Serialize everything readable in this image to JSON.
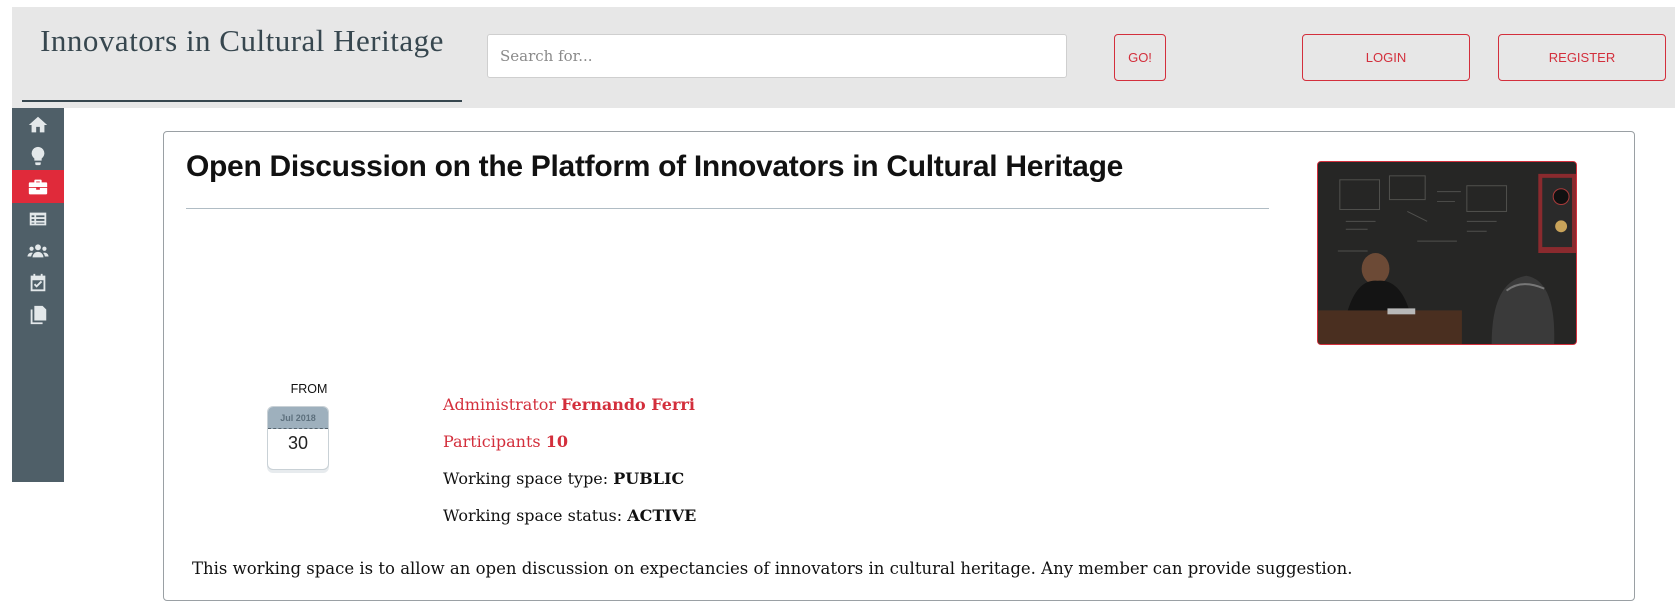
{
  "header": {
    "brand": "Innovators in Cultural Heritage",
    "search_placeholder": "Search for...",
    "go_label": "GO!",
    "login_label": "LOGIN",
    "register_label": "REGISTER",
    "background": "#e7e7e7"
  },
  "sidebar": {
    "items": [
      {
        "name": "home-icon",
        "active": false
      },
      {
        "name": "lightbulb-icon",
        "active": false
      },
      {
        "name": "briefcase-icon",
        "active": true
      },
      {
        "name": "list-icon",
        "active": false
      },
      {
        "name": "users-icon",
        "active": false
      },
      {
        "name": "calendar-check-icon",
        "active": false
      },
      {
        "name": "copy-icon",
        "active": false
      }
    ],
    "background": "#4f5f68",
    "active_color": "#e02a3a"
  },
  "space": {
    "title": "Open Discussion on the Platform of Innovators in Cultural Heritage",
    "from_label": "FROM",
    "date_month": "Jul 2018",
    "date_day": "30",
    "admin_label": "Administrator",
    "admin_name": "Fernando Ferri",
    "participants_label": "Participants",
    "participants_count": "10",
    "type_label": "Working space type:",
    "type_value": "PUBLIC",
    "status_label": "Working space status:",
    "status_value": "ACTIVE",
    "description": "This working space is to allow an open discussion on expectancies of innovators in cultural heritage. Any member can provide suggestion.",
    "accent": "#d32f3c"
  }
}
